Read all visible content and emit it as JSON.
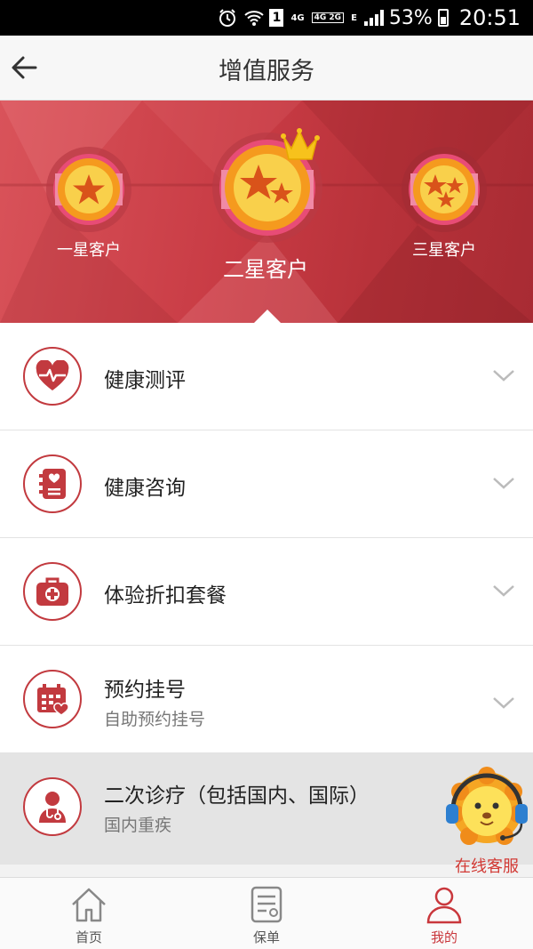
{
  "status_bar": {
    "network_4g": "4G",
    "network_4g2g": "4G 2G",
    "network_e": "E",
    "sim_slot": "1",
    "battery": "53%",
    "time": "20:51"
  },
  "header": {
    "title": "增值服务"
  },
  "tiers": [
    {
      "label": "一星客户",
      "stars": 1
    },
    {
      "label": "二星客户",
      "stars": 2,
      "selected": true
    },
    {
      "label": "三星客户",
      "stars": 3
    }
  ],
  "services": [
    {
      "title": "健康测评",
      "subtitle": "",
      "icon": "heart-pulse-icon"
    },
    {
      "title": "健康咨询",
      "subtitle": "",
      "icon": "consult-book-icon"
    },
    {
      "title": "体验折扣套餐",
      "subtitle": "",
      "icon": "medical-kit-icon"
    },
    {
      "title": "预约挂号",
      "subtitle": "自助预约挂号",
      "icon": "calendar-heart-icon"
    },
    {
      "title": "二次诊疗（包括国内、国际）",
      "subtitle": "国内重疾",
      "icon": "doctor-icon"
    }
  ],
  "customer_service": {
    "label": "在线客服"
  },
  "tab_bar": {
    "tabs": [
      {
        "label": "首页",
        "icon": "home-icon"
      },
      {
        "label": "保单",
        "icon": "policy-icon"
      },
      {
        "label": "我的",
        "icon": "profile-icon",
        "active": true
      }
    ]
  },
  "colors": {
    "brand_red": "#c23a3f",
    "banner_red": "#c83b44",
    "medal_orange": "#f39c12",
    "medal_yellow": "#f9cf4a"
  }
}
